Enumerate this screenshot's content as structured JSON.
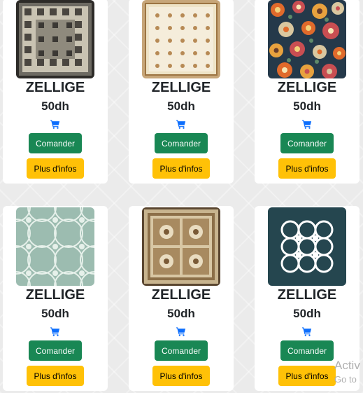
{
  "products": [
    {
      "name": "ZELLIGE",
      "price": "50dh",
      "order_label": "Comander",
      "info_label": "Plus d'infos"
    },
    {
      "name": "ZELLIGE",
      "price": "50dh",
      "order_label": "Comander",
      "info_label": "Plus d'infos"
    },
    {
      "name": "ZELLIGE",
      "price": "50dh",
      "order_label": "Comander",
      "info_label": "Plus d'infos"
    },
    {
      "name": "ZELLIGE",
      "price": "50dh",
      "order_label": "Comander",
      "info_label": "Plus d'infos"
    },
    {
      "name": "ZELLIGE",
      "price": "50dh",
      "order_label": "Comander",
      "info_label": "Plus d'infos"
    },
    {
      "name": "ZELLIGE",
      "price": "50dh",
      "order_label": "Comander",
      "info_label": "Plus d'infos"
    }
  ],
  "cart_icon": "shopping-cart-icon",
  "colors": {
    "order_button": "#198754",
    "info_button": "#ffc107",
    "cart_icon": "#0d6efd"
  },
  "watermark": {
    "line1": "Activ",
    "line2": "Go to"
  }
}
